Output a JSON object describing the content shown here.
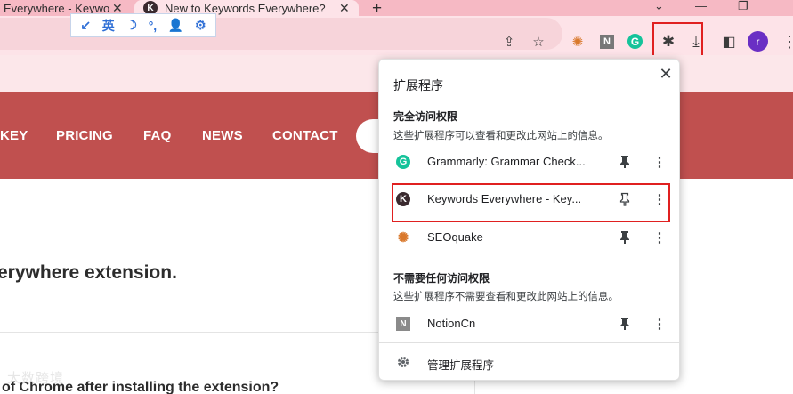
{
  "tabs": [
    {
      "title": "Everywhere - Keywo",
      "close": "✕",
      "active": false
    },
    {
      "title": "New to Keywords Everywhere?",
      "close": "✕",
      "active": true,
      "favicon": "K"
    }
  ],
  "new_tab_label": "+",
  "window_controls": {
    "dropdown": "⌄",
    "minimize": "—",
    "restore": "❐"
  },
  "ime_toolbar": {
    "items": [
      "↙",
      "英",
      "☽",
      "°,",
      "👤",
      "⚙"
    ]
  },
  "toolbar_icons": {
    "share": "⇪",
    "star": "☆",
    "seoquake": "✺",
    "notion": "N",
    "grammarly": "G",
    "extensions": "✱",
    "download": "⤓",
    "side_panel": "◧",
    "profile": "r",
    "menu": "⋮"
  },
  "nav": {
    "links": [
      "KEY",
      "PRICING",
      "FAQ",
      "NEWS",
      "CONTACT"
    ]
  },
  "page": {
    "heading": "erywhere extension.",
    "card_text": "of Chrome after installing the extension?",
    "watermark": "大数跨境"
  },
  "popup": {
    "title": "扩展程序",
    "close": "✕",
    "full_access": {
      "title": "完全访问权限",
      "description": "这些扩展程序可以查看和更改此网站上的信息。",
      "items": [
        {
          "name": "Grammarly: Grammar Check...",
          "icon": "G"
        },
        {
          "name": "Keywords Everywhere - Key...",
          "icon": "K"
        },
        {
          "name": "SEOquake",
          "icon": "✺"
        }
      ]
    },
    "no_access": {
      "title": "不需要任何访问权限",
      "description": "这些扩展程序不需要查看和更改此网站上的信息。",
      "items": [
        {
          "name": "NotionCn",
          "icon": "N"
        }
      ]
    },
    "manage_label": "管理扩展程序",
    "more_glyph": "⋮"
  },
  "colors": {
    "tab_strip": "#f6b9c4",
    "toolbar": "#fde3e8",
    "nav_bar": "#c0504f",
    "highlight": "#e02020",
    "grammarly": "#15c39a",
    "profile": "#6a2fc4"
  }
}
